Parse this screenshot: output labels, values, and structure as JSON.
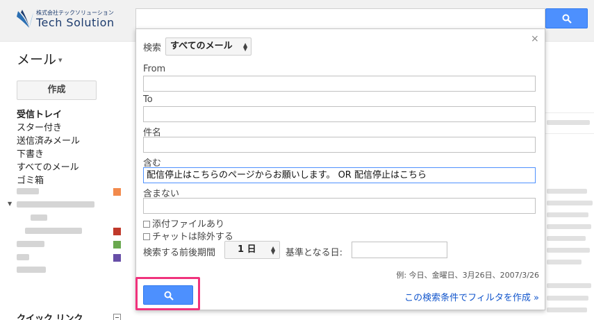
{
  "header": {
    "brand_sub": "株式会社テックソリューション",
    "brand_name": "Tech Solution",
    "search_icon": "search-icon"
  },
  "nav": {
    "mail_label": "メール",
    "compose_label": "作成",
    "items": [
      {
        "label": "受信トレイ",
        "bold": true
      },
      {
        "label": "スター付き",
        "bold": false
      },
      {
        "label": "送信済みメール",
        "bold": false
      },
      {
        "label": "下書き",
        "bold": false
      },
      {
        "label": "すべてのメール",
        "bold": false
      },
      {
        "label": "ゴミ箱",
        "bold": false
      }
    ],
    "label_colors": [
      "#f28a4c",
      "#c0392b",
      "#6aa84f",
      "#674ea7"
    ],
    "quick_links": "クイック リンク"
  },
  "dialog": {
    "scope_label": "検索",
    "scope_value": "すべてのメール",
    "from_label": "From",
    "from_value": "",
    "to_label": "To",
    "to_value": "",
    "subject_label": "件名",
    "subject_value": "",
    "has_words_label": "含む",
    "has_words_value": "配信停止はこちらのページからお願いします。 OR 配信停止はこちら",
    "doesnt_have_label": "含まない",
    "doesnt_have_value": "",
    "has_attachment_label": "添付ファイルあり",
    "exclude_chats_label": "チャットは除外する",
    "period_label": "検索する前後期間",
    "period_value": "1 日",
    "base_date_label": "基準となる日:",
    "base_date_value": "",
    "date_example": "例: 今日、金曜日、3月26日、2007/3/26",
    "create_filter_link": "この検索条件でフィルタを作成 »",
    "close_glyph": "×"
  },
  "colors": {
    "accent_blue": "#4d90fe",
    "highlight_pink": "#f0327c",
    "link_blue": "#1155cc"
  }
}
